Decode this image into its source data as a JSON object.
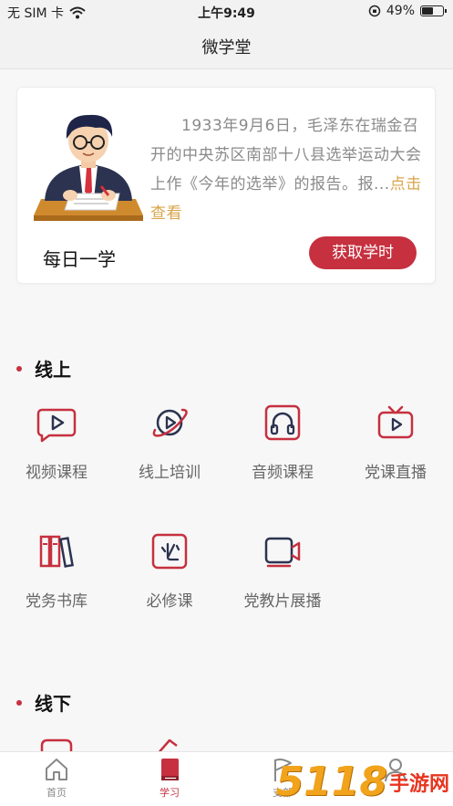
{
  "status_bar": {
    "carrier": "无 SIM 卡",
    "time": "上午9:49",
    "battery": "49%",
    "battery_level": 0.49
  },
  "nav": {
    "title": "微学堂"
  },
  "daily_card": {
    "excerpt": "1933年9月6日，毛泽东在瑞金召开的中央苏区南部十八县选举运动大会上作《今年的选举》的报告。报...",
    "more_link": "点击查看",
    "label": "每日一学",
    "button": "获取学时"
  },
  "online": {
    "title": "线上",
    "items": [
      {
        "label": "视频课程",
        "icon": "video-play-icon"
      },
      {
        "label": "线上培训",
        "icon": "online-training-icon"
      },
      {
        "label": "音频课程",
        "icon": "headphones-icon"
      },
      {
        "label": "党课直播",
        "icon": "live-tv-icon"
      },
      {
        "label": "党务书库",
        "icon": "books-icon"
      },
      {
        "label": "必修课",
        "icon": "required-course-icon"
      },
      {
        "label": "党教片展播",
        "icon": "video-camera-icon"
      }
    ]
  },
  "offline": {
    "title": "线下"
  },
  "tabs": [
    {
      "label": "首页",
      "icon": "home-icon",
      "active": false
    },
    {
      "label": "学习",
      "icon": "study-book-icon",
      "active": true
    },
    {
      "label": "支部",
      "icon": "flag-icon",
      "active": false
    },
    {
      "label": "",
      "icon": "user-icon",
      "active": false
    }
  ],
  "watermark": {
    "digits": "5118",
    "text": "手游网"
  },
  "colors": {
    "accent": "#c6303f",
    "link": "#d9a44a",
    "watermark_orange": "#f1a31b",
    "watermark_red": "#e8351f"
  }
}
